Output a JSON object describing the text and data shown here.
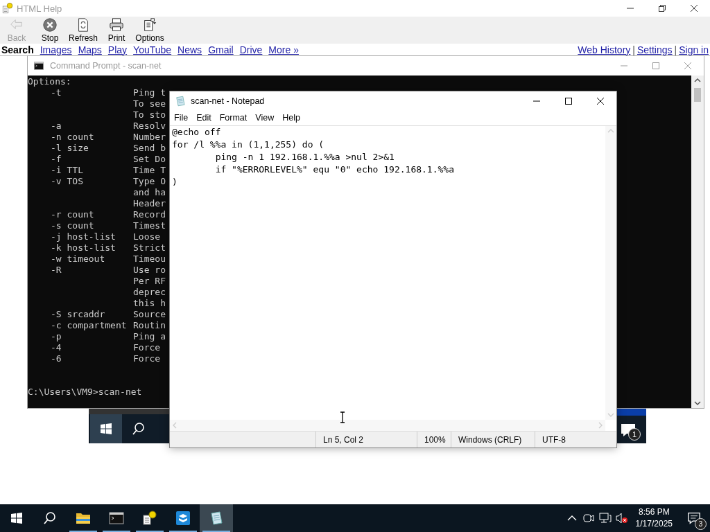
{
  "help_window": {
    "title": "HTML Help",
    "toolbar": [
      {
        "label": "Back",
        "kind": "back",
        "disabled": true
      },
      {
        "label": "Stop",
        "kind": "stop",
        "disabled": false
      },
      {
        "label": "Refresh",
        "kind": "refresh",
        "disabled": false
      },
      {
        "label": "Print",
        "kind": "print",
        "disabled": false
      },
      {
        "label": "Options",
        "kind": "options",
        "disabled": false
      }
    ],
    "links": [
      {
        "label": "Search",
        "selected": true
      },
      {
        "label": "Images",
        "selected": false
      },
      {
        "label": "Maps",
        "selected": false
      },
      {
        "label": "Play",
        "selected": false
      },
      {
        "label": "YouTube",
        "selected": false
      },
      {
        "label": "News",
        "selected": false
      },
      {
        "label": "Gmail",
        "selected": false
      },
      {
        "label": "Drive",
        "selected": false
      },
      {
        "label": "More »",
        "selected": false
      }
    ],
    "account_links": [
      {
        "kind": "link",
        "text": "Web History"
      },
      {
        "kind": "separator",
        "text": "|"
      },
      {
        "kind": "link",
        "text": "Settings"
      },
      {
        "kind": "separator",
        "text": "|"
      },
      {
        "kind": "link",
        "text": "Sign in"
      }
    ],
    "taskbar_image": {
      "badge": "1"
    }
  },
  "command_prompt": {
    "title": "Command Prompt - scan-net",
    "lines": [
      {
        "kind": "text",
        "text": "Options:"
      },
      {
        "kind": "option",
        "flag": "-t",
        "desc": "Ping t"
      },
      {
        "kind": "option",
        "desc": "To see"
      },
      {
        "kind": "option",
        "desc": "To sto"
      },
      {
        "kind": "option",
        "flag": "-a",
        "desc": "Resolv"
      },
      {
        "kind": "option",
        "flag": "-n count",
        "desc": "Number"
      },
      {
        "kind": "option",
        "flag": "-l size",
        "desc": "Send b"
      },
      {
        "kind": "option",
        "flag": "-f",
        "desc": "Set Do"
      },
      {
        "kind": "option",
        "flag": "-i TTL",
        "desc": "Time T"
      },
      {
        "kind": "option",
        "flag": "-v TOS",
        "desc": "Type O"
      },
      {
        "kind": "option",
        "desc": "and ha"
      },
      {
        "kind": "option",
        "desc": "Header"
      },
      {
        "kind": "option",
        "flag": "-r count",
        "desc": "Record"
      },
      {
        "kind": "option",
        "flag": "-s count",
        "desc": "Timest"
      },
      {
        "kind": "option",
        "flag": "-j host-list",
        "desc": "Loose"
      },
      {
        "kind": "option",
        "flag": "-k host-list",
        "desc": "Strict"
      },
      {
        "kind": "option",
        "flag": "-w timeout",
        "desc": "Timeou"
      },
      {
        "kind": "option",
        "flag": "-R",
        "desc": "Use ro"
      },
      {
        "kind": "option",
        "desc": "Per RF"
      },
      {
        "kind": "option",
        "desc": "deprec"
      },
      {
        "kind": "option",
        "desc": "this h"
      },
      {
        "kind": "option",
        "flag": "-S srcaddr",
        "desc": "Source"
      },
      {
        "kind": "option",
        "flag": "-c compartment",
        "desc": "Routin"
      },
      {
        "kind": "option",
        "flag": "-p",
        "desc": "Ping a"
      },
      {
        "kind": "option",
        "flag": "-4",
        "desc": "Force"
      },
      {
        "kind": "option",
        "flag": "-6",
        "desc": "Force"
      },
      {
        "kind": "blank"
      },
      {
        "kind": "blank"
      },
      {
        "kind": "prompt",
        "text": "C:\\Users\\VM9>scan-net"
      }
    ]
  },
  "notepad": {
    "title": "scan-net - Notepad",
    "menu": [
      "File",
      "Edit",
      "Format",
      "View",
      "Help"
    ],
    "lines": [
      "@echo off",
      "for /l %%a in (1,1,255) do (",
      "\tping -n 1 192.168.1.%%a >nul 2>&1",
      "\tif \"%ERRORLEVEL%\" equ \"0\" echo 192.168.1.%%a",
      ")"
    ],
    "status": {
      "position": "Ln 5, Col 2",
      "zoom": "100%",
      "line_endings": "Windows (CRLF)",
      "encoding": "UTF-8"
    }
  },
  "taskbar": {
    "apps": [
      {
        "kind": "explorer",
        "selected": false
      },
      {
        "kind": "terminal",
        "selected": false
      },
      {
        "kind": "help",
        "selected": false
      },
      {
        "kind": "app",
        "selected": false
      },
      {
        "kind": "notepad",
        "selected": true
      }
    ],
    "time": "8:56 PM",
    "date": "1/17/2025",
    "notification_count": "3"
  }
}
